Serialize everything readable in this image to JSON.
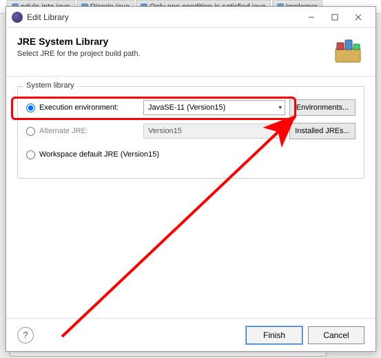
{
  "bg_tabs": [
    {
      "label": "ndule-into.iava"
    },
    {
      "label": "Disprin iava"
    },
    {
      "label": "Only one condition is satisfied iava"
    },
    {
      "label": "Implemer"
    }
  ],
  "titlebar": {
    "title": "Edit Library"
  },
  "header": {
    "heading": "JRE System Library",
    "subheading": "Select JRE for the project build path."
  },
  "group": {
    "legend": "System library",
    "rows": {
      "exec_env": {
        "label": "Execution environment:",
        "value": "JavaSE-11 (Version15)",
        "button": "Environments..."
      },
      "alt_jre": {
        "label": "Alternate JRE:",
        "value": "Version15",
        "button": "Installed JREs..."
      },
      "workspace": {
        "label": "Workspace default JRE (Version15)"
      }
    }
  },
  "buttons": {
    "finish": "Finish",
    "cancel": "Cancel"
  }
}
